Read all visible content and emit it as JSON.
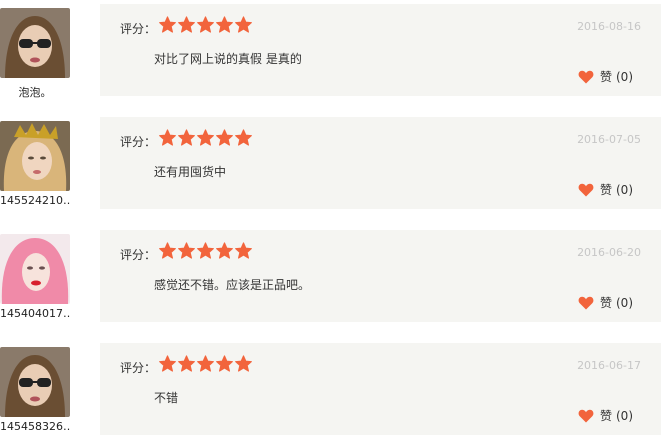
{
  "colors": {
    "star": "#f2643c",
    "heart": "#f2643c",
    "card_bg": "#f5f5f2",
    "date": "#c6c6c6"
  },
  "reviews": [
    {
      "username": "泡泡。",
      "score_label": "评分：",
      "stars": 5,
      "date": "2016-08-16",
      "content": "对比了网上说的真假 是真的",
      "like_label": "赞",
      "like_count": "(0)"
    },
    {
      "username": "145524210…",
      "score_label": "评分：",
      "stars": 5,
      "date": "2016-07-05",
      "content": "还有用囤货中",
      "like_label": "赞",
      "like_count": "(0)"
    },
    {
      "username": "145404017…",
      "score_label": "评分：",
      "stars": 5,
      "date": "2016-06-20",
      "content": "感觉还不错。应该是正品吧。",
      "like_label": "赞",
      "like_count": "(0)"
    },
    {
      "username": "145458326…",
      "score_label": "评分：",
      "stars": 5,
      "date": "2016-06-17",
      "content": "不错",
      "like_label": "赞",
      "like_count": "(0)"
    }
  ]
}
